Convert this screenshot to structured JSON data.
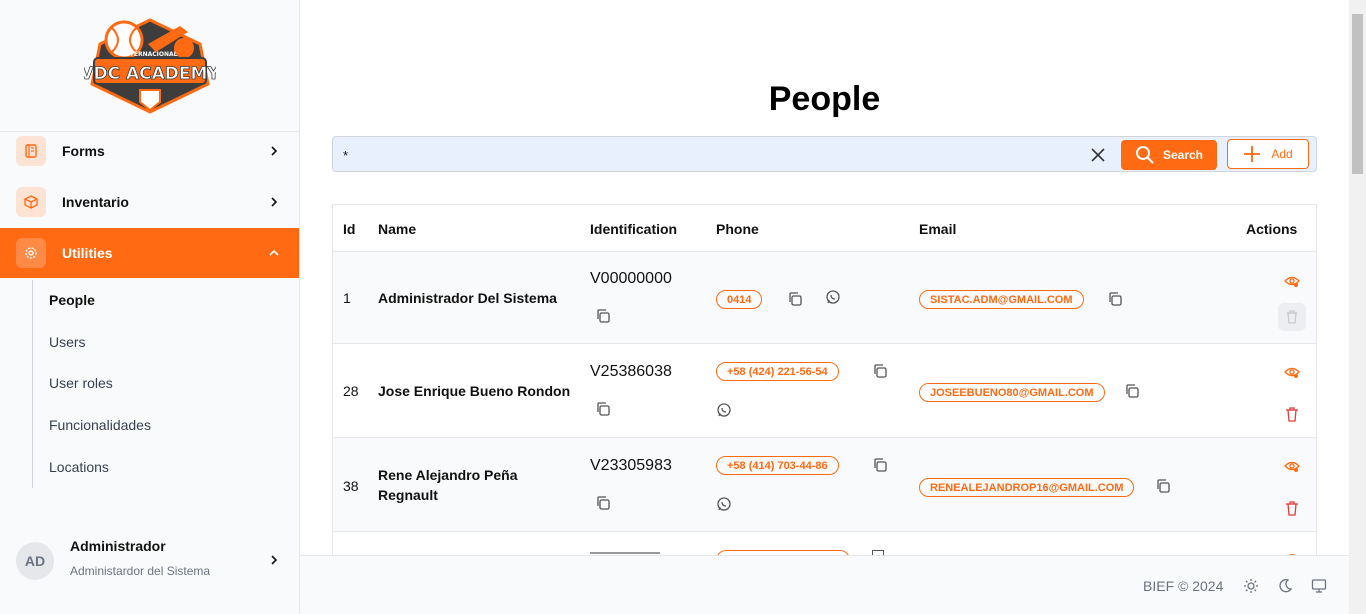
{
  "brand": {
    "logo_text": "VDC ACADEMY",
    "logo_subtext": "INTERNACIONAL",
    "accent": "#ff6a13"
  },
  "sidebar": {
    "items": [
      {
        "label": "Forms",
        "icon": "notebook-icon"
      },
      {
        "label": "Inventario",
        "icon": "box-icon"
      },
      {
        "label": "Utilities",
        "icon": "gear-icon"
      }
    ],
    "subitems": [
      "People",
      "Users",
      "User roles",
      "Funcionalidades",
      "Locations"
    ],
    "user": {
      "initials": "AD",
      "name": "Administrador",
      "role": "Administardor del Sistema"
    }
  },
  "main": {
    "title": "People",
    "search": {
      "value": "*",
      "button": "Search",
      "add": "Add"
    },
    "columns": [
      "Id",
      "Name",
      "Identification",
      "Phone",
      "Email",
      "Actions"
    ],
    "rows": [
      {
        "id": "1",
        "name": "Administrador Del Sistema",
        "identification": "V00000000",
        "phone": "0414",
        "email": "SISTAC.ADM@GMAIL.COM"
      },
      {
        "id": "28",
        "name": "Jose Enrique Bueno Rondon",
        "identification": "V25386038",
        "phone": "+58 (424) 221-56-54",
        "email": "JOSEEBUENO80@GMAIL.COM"
      },
      {
        "id": "38",
        "name": "Rene Alejandro Peña Regnault",
        "identification": "V23305983",
        "phone": "+58 (414) 703-44-86",
        "email": "RENEALEJANDROP16@GMAIL.COM"
      }
    ]
  },
  "footer": {
    "copyright": "BIEF © 2024"
  }
}
